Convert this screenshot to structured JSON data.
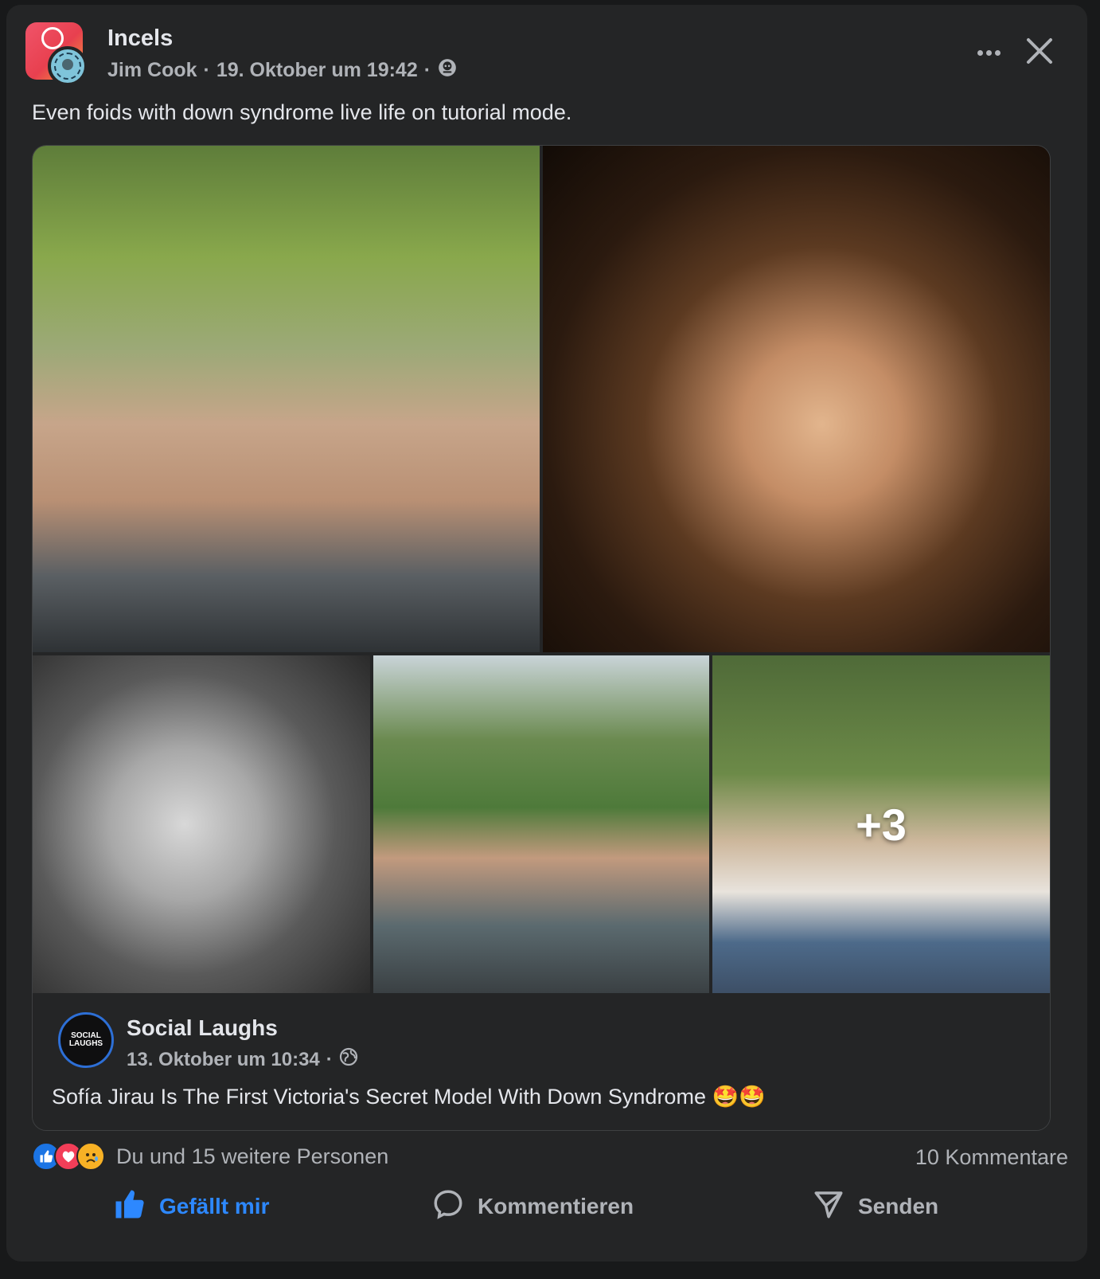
{
  "post": {
    "group_name": "Incels",
    "author": "Jim Cook",
    "timestamp": "19. Oktober um 19:42",
    "separator": "·",
    "privacy_icon": "group-members-icon",
    "text": "Even foids with down syndrome live life on tutorial mode."
  },
  "gallery": {
    "more_count": "+3"
  },
  "shared_post": {
    "source_name": "Social Laughs",
    "source_logo_text": "SOCIAL LAUGHS",
    "timestamp": "13. Oktober um 10:34",
    "separator": "·",
    "privacy_icon": "globe-icon",
    "text": "Sofía Jirau Is The First Victoria's Secret Model With Down Syndrome 🤩🤩"
  },
  "stats": {
    "reactions": [
      "like",
      "love",
      "sad"
    ],
    "reaction_text": "Du und 15 weitere Personen",
    "comments": "10 Kommentare"
  },
  "actions": {
    "like": "Gefällt mir",
    "comment": "Kommentieren",
    "send": "Senden"
  },
  "colors": {
    "background": "#18191a",
    "card": "#242526",
    "text_primary": "#e4e6eb",
    "text_secondary": "#b0b3b8",
    "accent_blue": "#2d88ff"
  }
}
